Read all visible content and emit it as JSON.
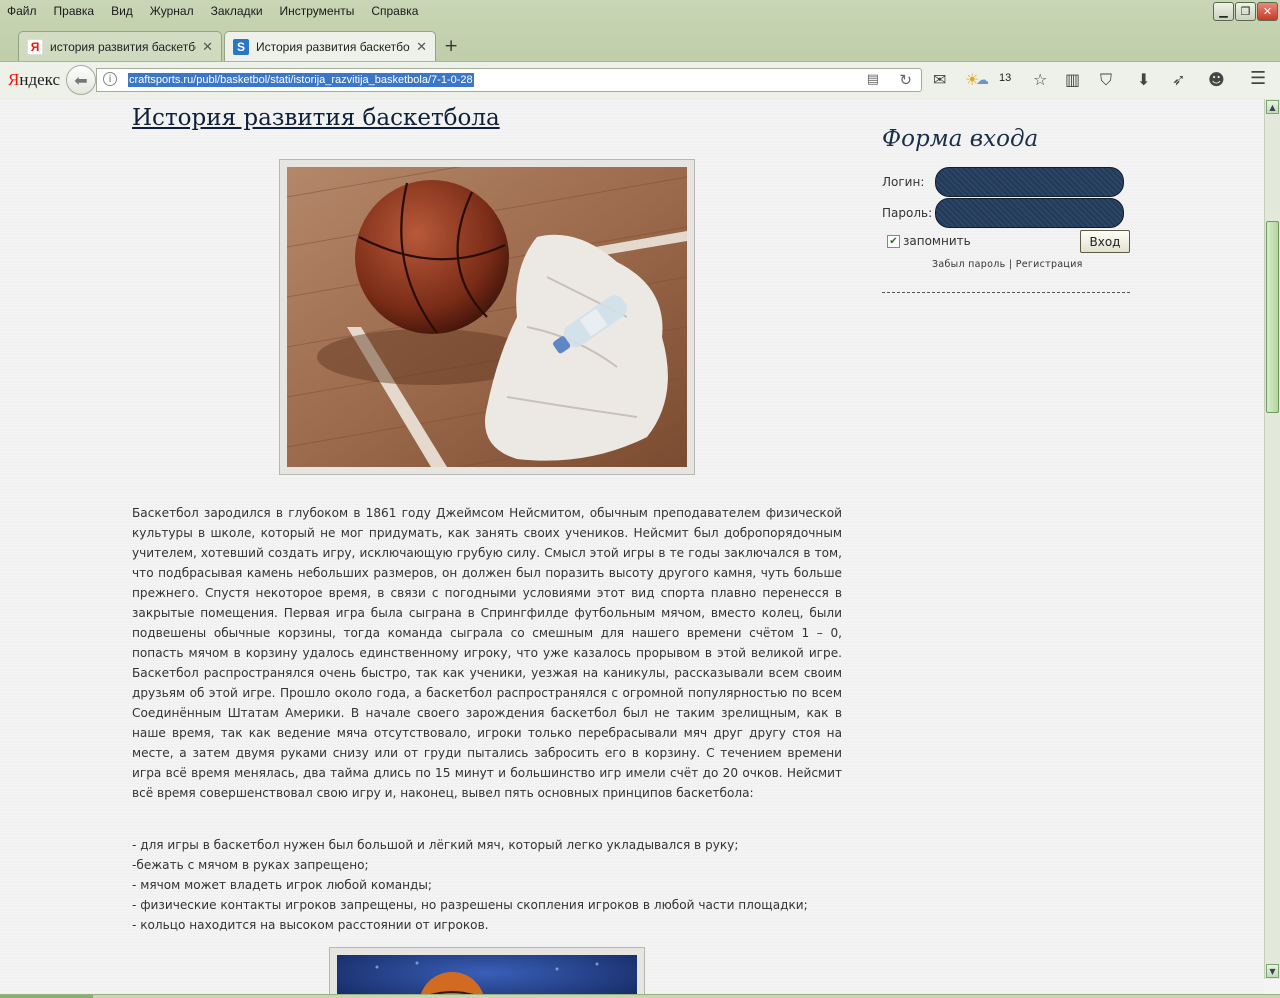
{
  "menu": [
    "Файл",
    "Правка",
    "Вид",
    "Журнал",
    "Закладки",
    "Инструменты",
    "Справка"
  ],
  "window_controls": {
    "minimize": "▁",
    "restore": "❐",
    "close": "✕"
  },
  "tabs": [
    {
      "title": "история развития баскетбо...",
      "favicon": "yandex-icon",
      "active": false
    },
    {
      "title": "История развития баскетбо...",
      "favicon": "s-site-icon",
      "active": true
    }
  ],
  "new_tab": "+",
  "navbar": {
    "logo_first": "Я",
    "logo_rest": "ндекс",
    "url": "craftsports.ru/publ/basketbol/stati/istorija_razvitija_basketbola/7-1-0-28",
    "weather_temp": "13"
  },
  "article": {
    "title": "История развития баскетбола",
    "body": "Баскетбол зародился в глубоком в 1861 году Джеймсом Нейсмитом, обычным преподавателем физической культуры в школе, который не мог придумать, как занять своих учеников. Нейсмит был добропорядочным учителем, хотевший создать игру, исключающую грубую силу. Смысл этой игры в те годы заключался в том, что подбрасывая камень небольших размеров, он должен был поразить высоту другого камня, чуть больше прежнего. Спустя некоторое время, в связи с погодными условиями этот вид спорта плавно перенесся в закрытые помещения. Первая игра была сыграна в Спрингфилде футбольным мячом, вместо колец, были подвешены обычные корзины, тогда команда сыграла со смешным для нашего времени счётом 1 – 0, попасть мячом в корзину удалось единственному игроку, что уже казалось прорывом в этой великой игре. Баскетбол распространялся очень быстро, так как ученики, уезжая на каникулы, рассказывали всем своим друзьям об этой игре. Прошло около года, а баскетбол распространялся с огромной популярностью по всем Соединённым Штатам Америки. В начале своего зарождения баскетбол был не таким зрелищным, как в наше время, так как ведение мяча отсутствовало, игроки только перебрасывали мяч друг другу стоя на месте, а затем двумя руками снизу или от груди пытались забросить его в корзину. С течением времени игра всё время менялась, два тайма длись по 15 минут и большинство игр имели счёт до 20 очков. Нейсмит всё время совершенствовал свою игру и, наконец, вывел пять основных принципов баскетбола:",
    "rules": [
      "- для игры в баскетбол нужен был большой и лёгкий мяч, который легко укладывался в руку;",
      "-бежать с мячом в руках запрещено;",
      "- мячом может владеть игрок любой команды;",
      "- физические контакты игроков запрещены, но разрешены скопления игроков в любой части площадки;",
      "- кольцо находится на высоком расстоянии от игроков."
    ]
  },
  "login": {
    "title": "Форма входа",
    "login_label": "Логин:",
    "password_label": "Пароль:",
    "remember_label": "запомнить",
    "remember_checked": true,
    "submit": "Вход",
    "forgot": "Забыл пароль",
    "separator": "|",
    "register": "Регистрация"
  }
}
